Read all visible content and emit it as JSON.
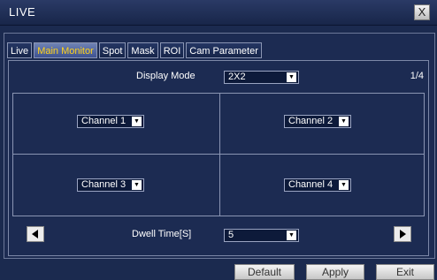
{
  "window": {
    "title": "LIVE",
    "close_icon": "close-icon",
    "close_glyph": "X"
  },
  "tabs": [
    {
      "label": "Live"
    },
    {
      "label": "Main Monitor",
      "active": true
    },
    {
      "label": "Spot"
    },
    {
      "label": "Mask"
    },
    {
      "label": "ROI"
    },
    {
      "label": "Cam Parameter"
    }
  ],
  "display_mode": {
    "label": "Display Mode",
    "value": "2X2"
  },
  "page_indicator": "1/4",
  "channels": [
    {
      "value": "Channel 1"
    },
    {
      "value": "Channel 2"
    },
    {
      "value": "Channel 3"
    },
    {
      "value": "Channel 4"
    }
  ],
  "dwell": {
    "label": "Dwell Time[S]",
    "value": "5"
  },
  "nav": {
    "prev_icon": "left-arrow-icon",
    "next_icon": "right-arrow-icon"
  },
  "buttons": {
    "default": "Default",
    "apply": "Apply",
    "exit": "Exit"
  },
  "colors": {
    "background": "#1b2a4f",
    "active_tab_text": "#ffd21a"
  }
}
